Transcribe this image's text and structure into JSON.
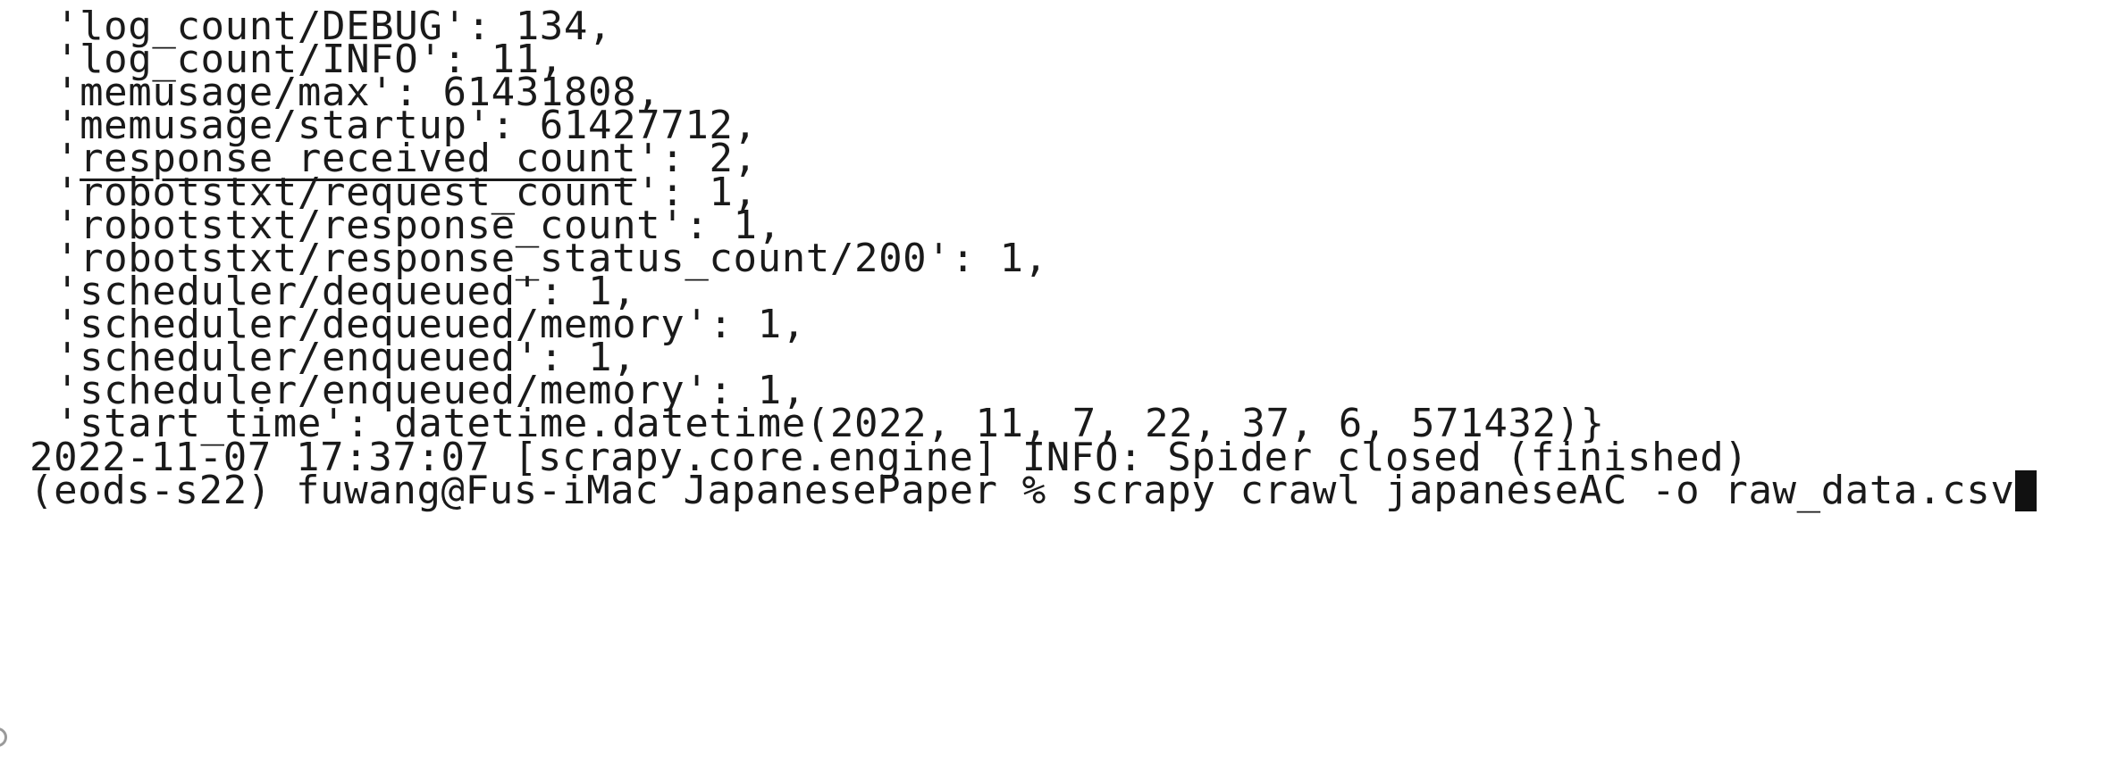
{
  "terminal": {
    "stats_lines": [
      "'log_count/DEBUG': 134,",
      "'log_count/INFO': 11,",
      "'memusage/max': 61431808,",
      "'memusage/startup': 61427712,",
      {
        "prefix": "'",
        "underlined": "response_received_count",
        "suffix": "': 2,"
      },
      "'robotstxt/request_count': 1,",
      "'robotstxt/response_count': 1,",
      "'robotstxt/response_status_count/200': 1,",
      "'scheduler/dequeued': 1,",
      "'scheduler/dequeued/memory': 1,",
      "'scheduler/enqueued': 1,",
      "'scheduler/enqueued/memory': 1,",
      "'start_time': datetime.datetime(2022, 11, 7, 22, 37, 6, 571432)}"
    ],
    "log_line": "2022-11-07 17:37:07 [scrapy.core.engine] INFO: Spider closed (finished)",
    "prompt": {
      "env": "(eods-s22)",
      "user_host": "fuwang@Fus-iMac",
      "cwd": "JapanesePaper",
      "symbol": "%",
      "command": "scrapy crawl japaneseAC -o raw_data.csv"
    }
  }
}
